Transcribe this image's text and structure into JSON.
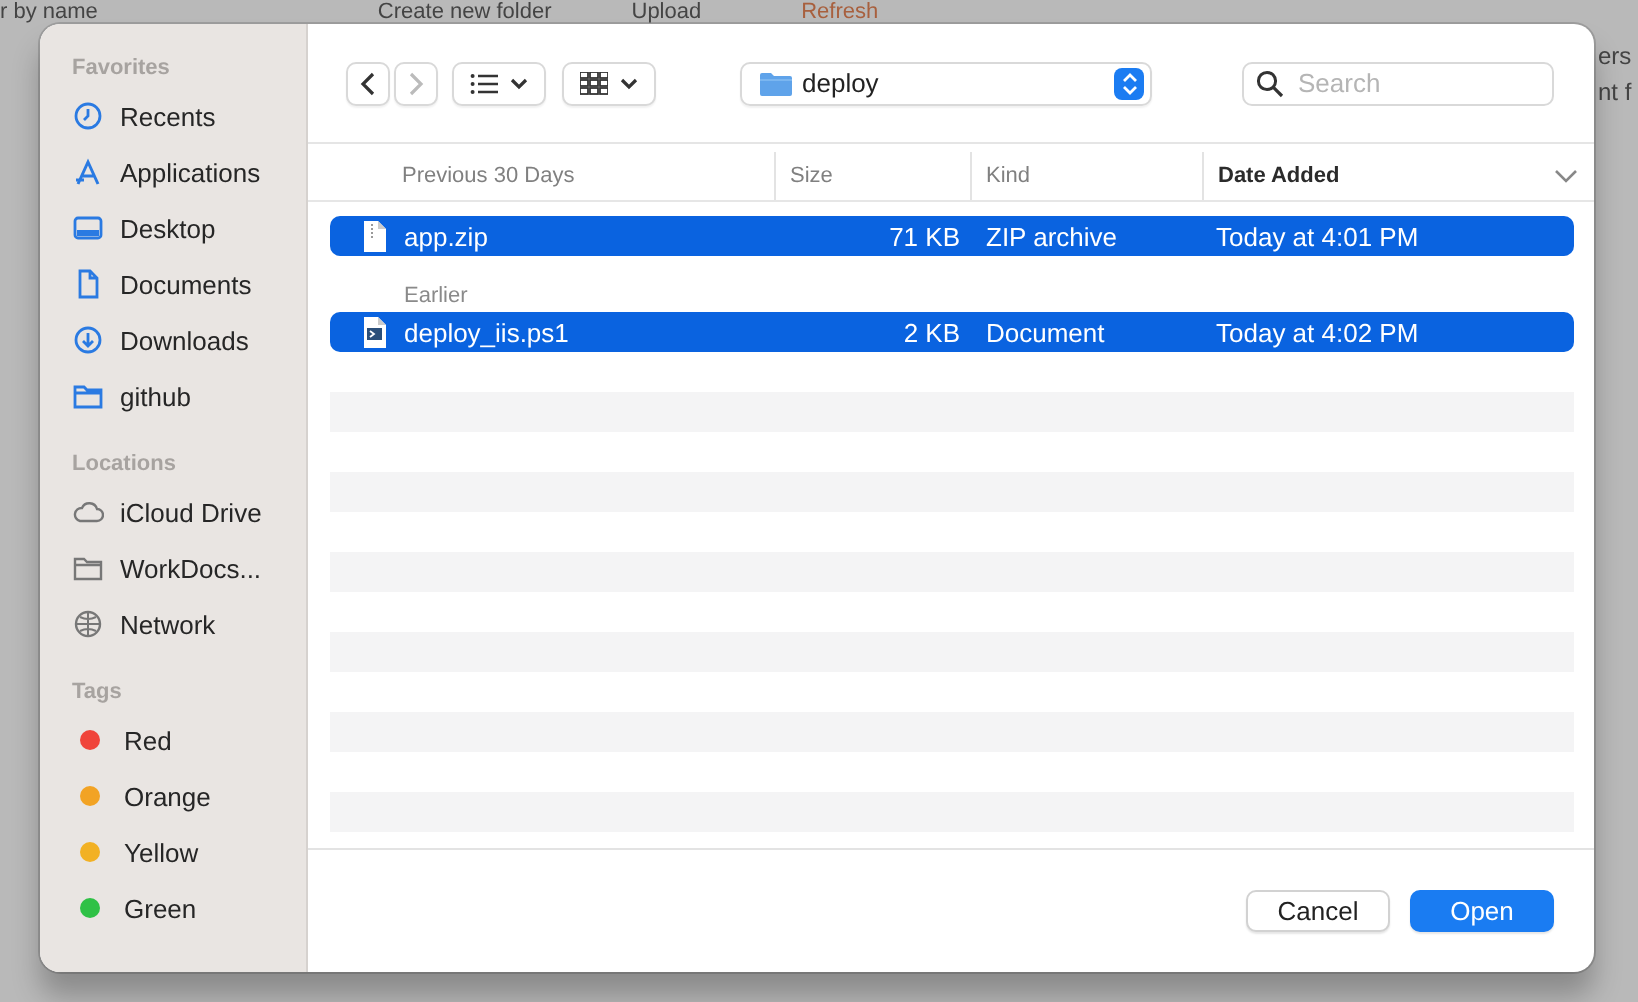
{
  "background_page": {
    "texts": [
      "r by name",
      "Create new folder",
      "Upload",
      "Refresh",
      "ers",
      "nt f"
    ]
  },
  "dialog": {
    "sidebar": [
      {
        "heading": "Favorites",
        "items": [
          {
            "label": "Recents"
          },
          {
            "label": "Applications"
          },
          {
            "label": "Desktop"
          },
          {
            "label": "Documents"
          },
          {
            "label": "Downloads"
          },
          {
            "label": "github"
          }
        ]
      },
      {
        "heading": "Locations",
        "items": [
          {
            "label": "iCloud Drive"
          },
          {
            "label": "WorkDocs..."
          },
          {
            "label": "Network"
          }
        ]
      },
      {
        "heading": "Tags",
        "items": [
          {
            "label": "Red",
            "color": "#f0443a"
          },
          {
            "label": "Orange",
            "color": "#f2a324"
          },
          {
            "label": "Yellow",
            "color": "#f2b124"
          },
          {
            "label": "Green",
            "color": "#2fc146"
          }
        ]
      }
    ],
    "toolbar": {
      "back_disabled": false,
      "forward_disabled": true,
      "location": "deploy",
      "search": {
        "placeholder": "Search"
      }
    },
    "columns": [
      {
        "label": "Previous 30 Days",
        "sorted": false
      },
      {
        "label": "Size",
        "sorted": false
      },
      {
        "label": "Kind",
        "sorted": false
      },
      {
        "label": "Date Added",
        "sorted": true
      }
    ],
    "rows": [
      {
        "kind": "file",
        "selected": true,
        "name": "app.zip",
        "size": "71 KB",
        "file_type": "ZIP archive",
        "date_added": "Today at 4:01 PM"
      },
      {
        "kind": "group",
        "label": "Earlier"
      },
      {
        "kind": "file",
        "selected": true,
        "name": "deploy_iis.ps1",
        "size": "2 KB",
        "file_type": "Document",
        "date_added": "Today at 4:02 PM"
      }
    ],
    "buttons": [
      {
        "label": "Cancel",
        "default": false
      },
      {
        "label": "Open",
        "default": true
      }
    ]
  }
}
